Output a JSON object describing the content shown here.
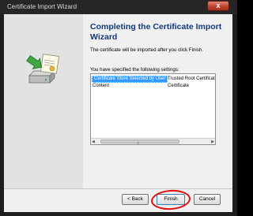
{
  "window": {
    "title": "Certificate Import Wizard",
    "close_label": "x"
  },
  "wizard": {
    "heading": "Completing the Certificate Import Wizard",
    "description": "The certificate will be imported after you click Finish.",
    "settings_label": "You have specified the following settings:",
    "settings": [
      {
        "name": "Certificate Store Selected by User",
        "value": "Trusted Root Certificat"
      },
      {
        "name": "Content",
        "value": "Certificate"
      }
    ]
  },
  "buttons": {
    "back": "< Back",
    "finish": "Finish",
    "cancel": "Cancel"
  },
  "icons": {
    "wizard": "certificate-import-icon",
    "close": "close-icon"
  },
  "colors": {
    "heading": "#123a78",
    "selection": "#3399ff",
    "annotation": "#e01010"
  }
}
